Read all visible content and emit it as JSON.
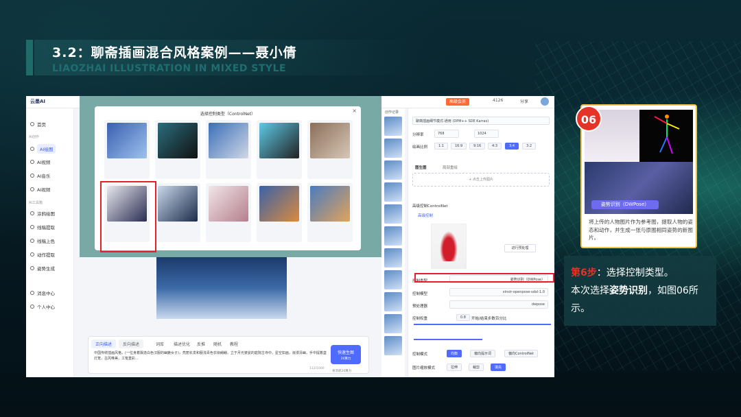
{
  "slide": {
    "title": "3.2：聊斋插画混合风格案例——聂小倩",
    "subtitle": "LIAOZHAI ILLUSTRATION IN MIXED STYLE"
  },
  "app": {
    "logo": "云墨AI",
    "topbar": {
      "vip": "高级会员",
      "count": "4126",
      "share": "分享"
    },
    "nav": {
      "home": "首页",
      "section_create": "AI创作",
      "ai_draw": "AI绘图",
      "ai_video": "AI视频",
      "ai_music": "AI音乐",
      "ai_speak": "AI视频",
      "section_tools": "AI工具箱",
      "tool1": "涂鸦绘图",
      "tool2": "线稿提取",
      "tool3": "线稿上色",
      "tool4": "动作提取",
      "tool5": "姿势生成",
      "messages": "消息中心",
      "profile": "个人中心"
    },
    "modal": {
      "title": "选择控制类型（ControlNet）",
      "close": "×"
    },
    "prompt": {
      "tab_active": "正向描述",
      "tab_inactive": "反向描述",
      "toolbar": [
        "词库",
        "描述优化",
        "反推",
        "随机",
        "教程"
      ],
      "text": "中国传统插画风格，(一位身着飘逸白色汉服的幽魅女子)，亮丽长发和服浅青色衣袂翩翩，立于月光婆娑的庭院古寺中，星空如画，浪漫清幽，手中提着盏灯笼，古风唯美，工笔重彩...",
      "counter": "112/1000",
      "generate": "快速生图",
      "generate_sub": "20算力",
      "cost_note": "将消耗20算力"
    },
    "history_label": "创作记录",
    "right": {
      "model": "聊斋插画细节模式-通用 (DPM++ SDE Karras)",
      "resolution_label": "分辨率",
      "width": "768",
      "height": "1024",
      "ratio_label": "绘画比例",
      "ratios": [
        "1:1",
        "16:9",
        "9:16",
        "4:3",
        "3:4",
        "3:2"
      ],
      "ref_tab1": "图生图",
      "ref_tab2": "局部重绘",
      "upload": "+ 点击上传图片",
      "controlnet": "高级控制ControlNet",
      "controlnet_check": "高级控制",
      "ctl_btn": "进行预处理",
      "type_label": "控制类型",
      "type_value": "姿势识别（DWPose）",
      "model_label": "控制模型",
      "model_value": "xinsir-openpose-sdxl-1.0",
      "pre_label": "预处理器",
      "pre_value": "dwpose",
      "weight_label": "控制权重",
      "weight_value": "0.8",
      "start_label": "开始/结束步数百分比",
      "cutoff_label": "控制模式",
      "cutoff_opts": [
        "均衡",
        "偏向提示词",
        "偏向ControlNet"
      ],
      "resize_label": "图片缩放模式",
      "resize_opts": [
        "拉伸",
        "裁剪",
        "填充"
      ]
    }
  },
  "example": {
    "step_number": "06",
    "pill": "姿势识别（DWPose）",
    "desc": "将上传的人物图片作为参考图，提取人物的姿态和动作，并生成一张与原图相同姿势的新图片。"
  },
  "instruction": {
    "step": "第6步",
    "line1": "：选择控制类型。",
    "line2a": "本次选择",
    "line2b": "姿势识别",
    "line2c": "，如图06所示。"
  },
  "colors": {
    "accent": "#e5332a",
    "teal": "#1e6e6f",
    "primary": "#4f6bff"
  }
}
